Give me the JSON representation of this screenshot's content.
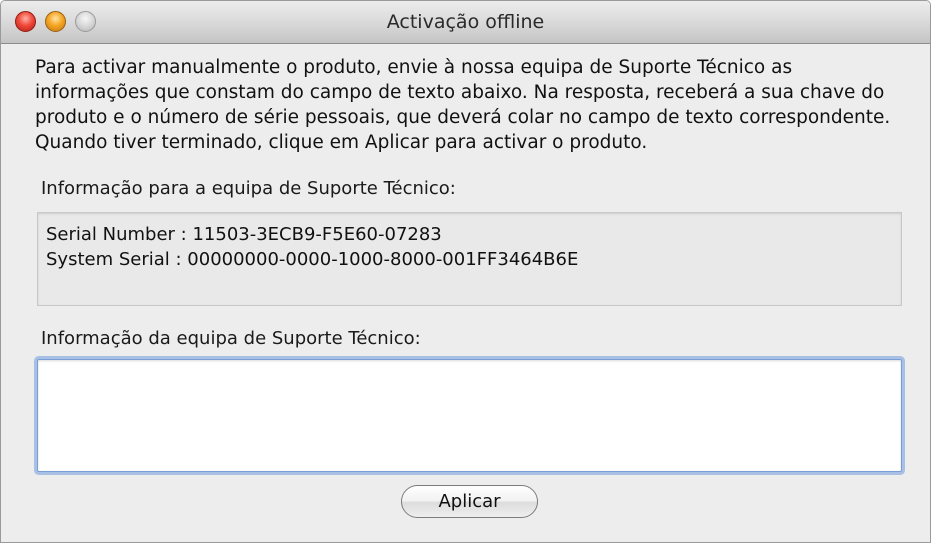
{
  "window": {
    "title": "Activação offline"
  },
  "intro_text": "Para activar manualmente o produto, envie à nossa equipa de Suporte Técnico as informações que constam do campo de texto abaixo. Na resposta, receberá a sua chave do produto e o número de série pessoais, que deverá colar no campo de texto correspondente. Quando tiver terminado, clique em Aplicar para activar o produto.",
  "info_for_support": {
    "label": "Informação para a equipa de Suporte Técnico:",
    "lines": [
      "Serial Number : 11503-3ECB9-F5E60-07283",
      "System Serial : 00000000-0000-1000-8000-001FF3464B6E"
    ]
  },
  "info_from_support": {
    "label": "Informação da equipa de Suporte Técnico:",
    "value": ""
  },
  "buttons": {
    "apply_label": "Aplicar"
  },
  "icons": {
    "close": "close-icon",
    "minimize": "minimize-icon",
    "zoom": "zoom-icon"
  },
  "colors": {
    "close": "#f04a3b",
    "minimize": "#f5a623",
    "zoom_inactive": "#d4d4d4",
    "focus_ring": "#6e9bdc"
  }
}
